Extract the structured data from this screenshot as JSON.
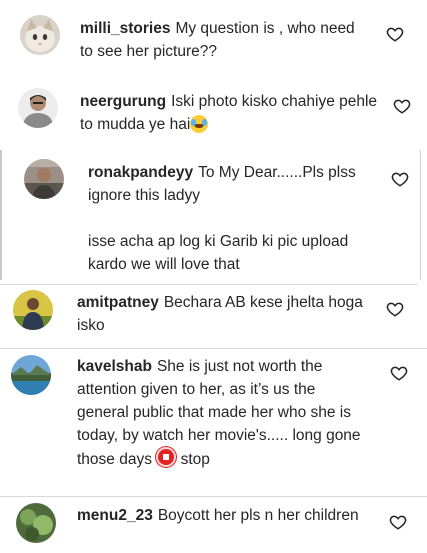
{
  "comments": [
    {
      "username": "milli_stories",
      "text": "My question is , who need to see her picture??",
      "avatar_icon": "cat-avatar-icon"
    },
    {
      "username": "neergurung",
      "text": "Iski photo kisko chahiye pehle to mudda ye hai",
      "emoji": "laughing-tears-emoji",
      "avatar_icon": "man-avatar-icon"
    },
    {
      "username": "ronakpandeyy",
      "text": "To My Dear......Pls plss ignore this ladyy",
      "text2": "isse acha ap log ki Garib ki pic upload kardo we will love that",
      "avatar_icon": "person-avatar-icon"
    },
    {
      "username": "amitpatney",
      "text": "Bechara AB kese jhelta hoga isko",
      "avatar_icon": "man-outdoor-avatar-icon"
    },
    {
      "username": "kavelshab",
      "text": "She is just not worth the attention given to her, as it’s us the general public that made her who she is today, by watch her movie's..... long gone those days",
      "text_end": "stop",
      "emoji": "stop-sign-emoji",
      "avatar_icon": "landscape-avatar-icon"
    },
    {
      "username": "menu2_23",
      "text": "Boycott her pls n her children",
      "avatar_icon": "plant-avatar-icon"
    }
  ],
  "colors": {
    "text": "#262626",
    "heart_outline": "#262626",
    "divider": "#d8d8d8"
  },
  "icons": {
    "like": "heart-outline-icon"
  }
}
